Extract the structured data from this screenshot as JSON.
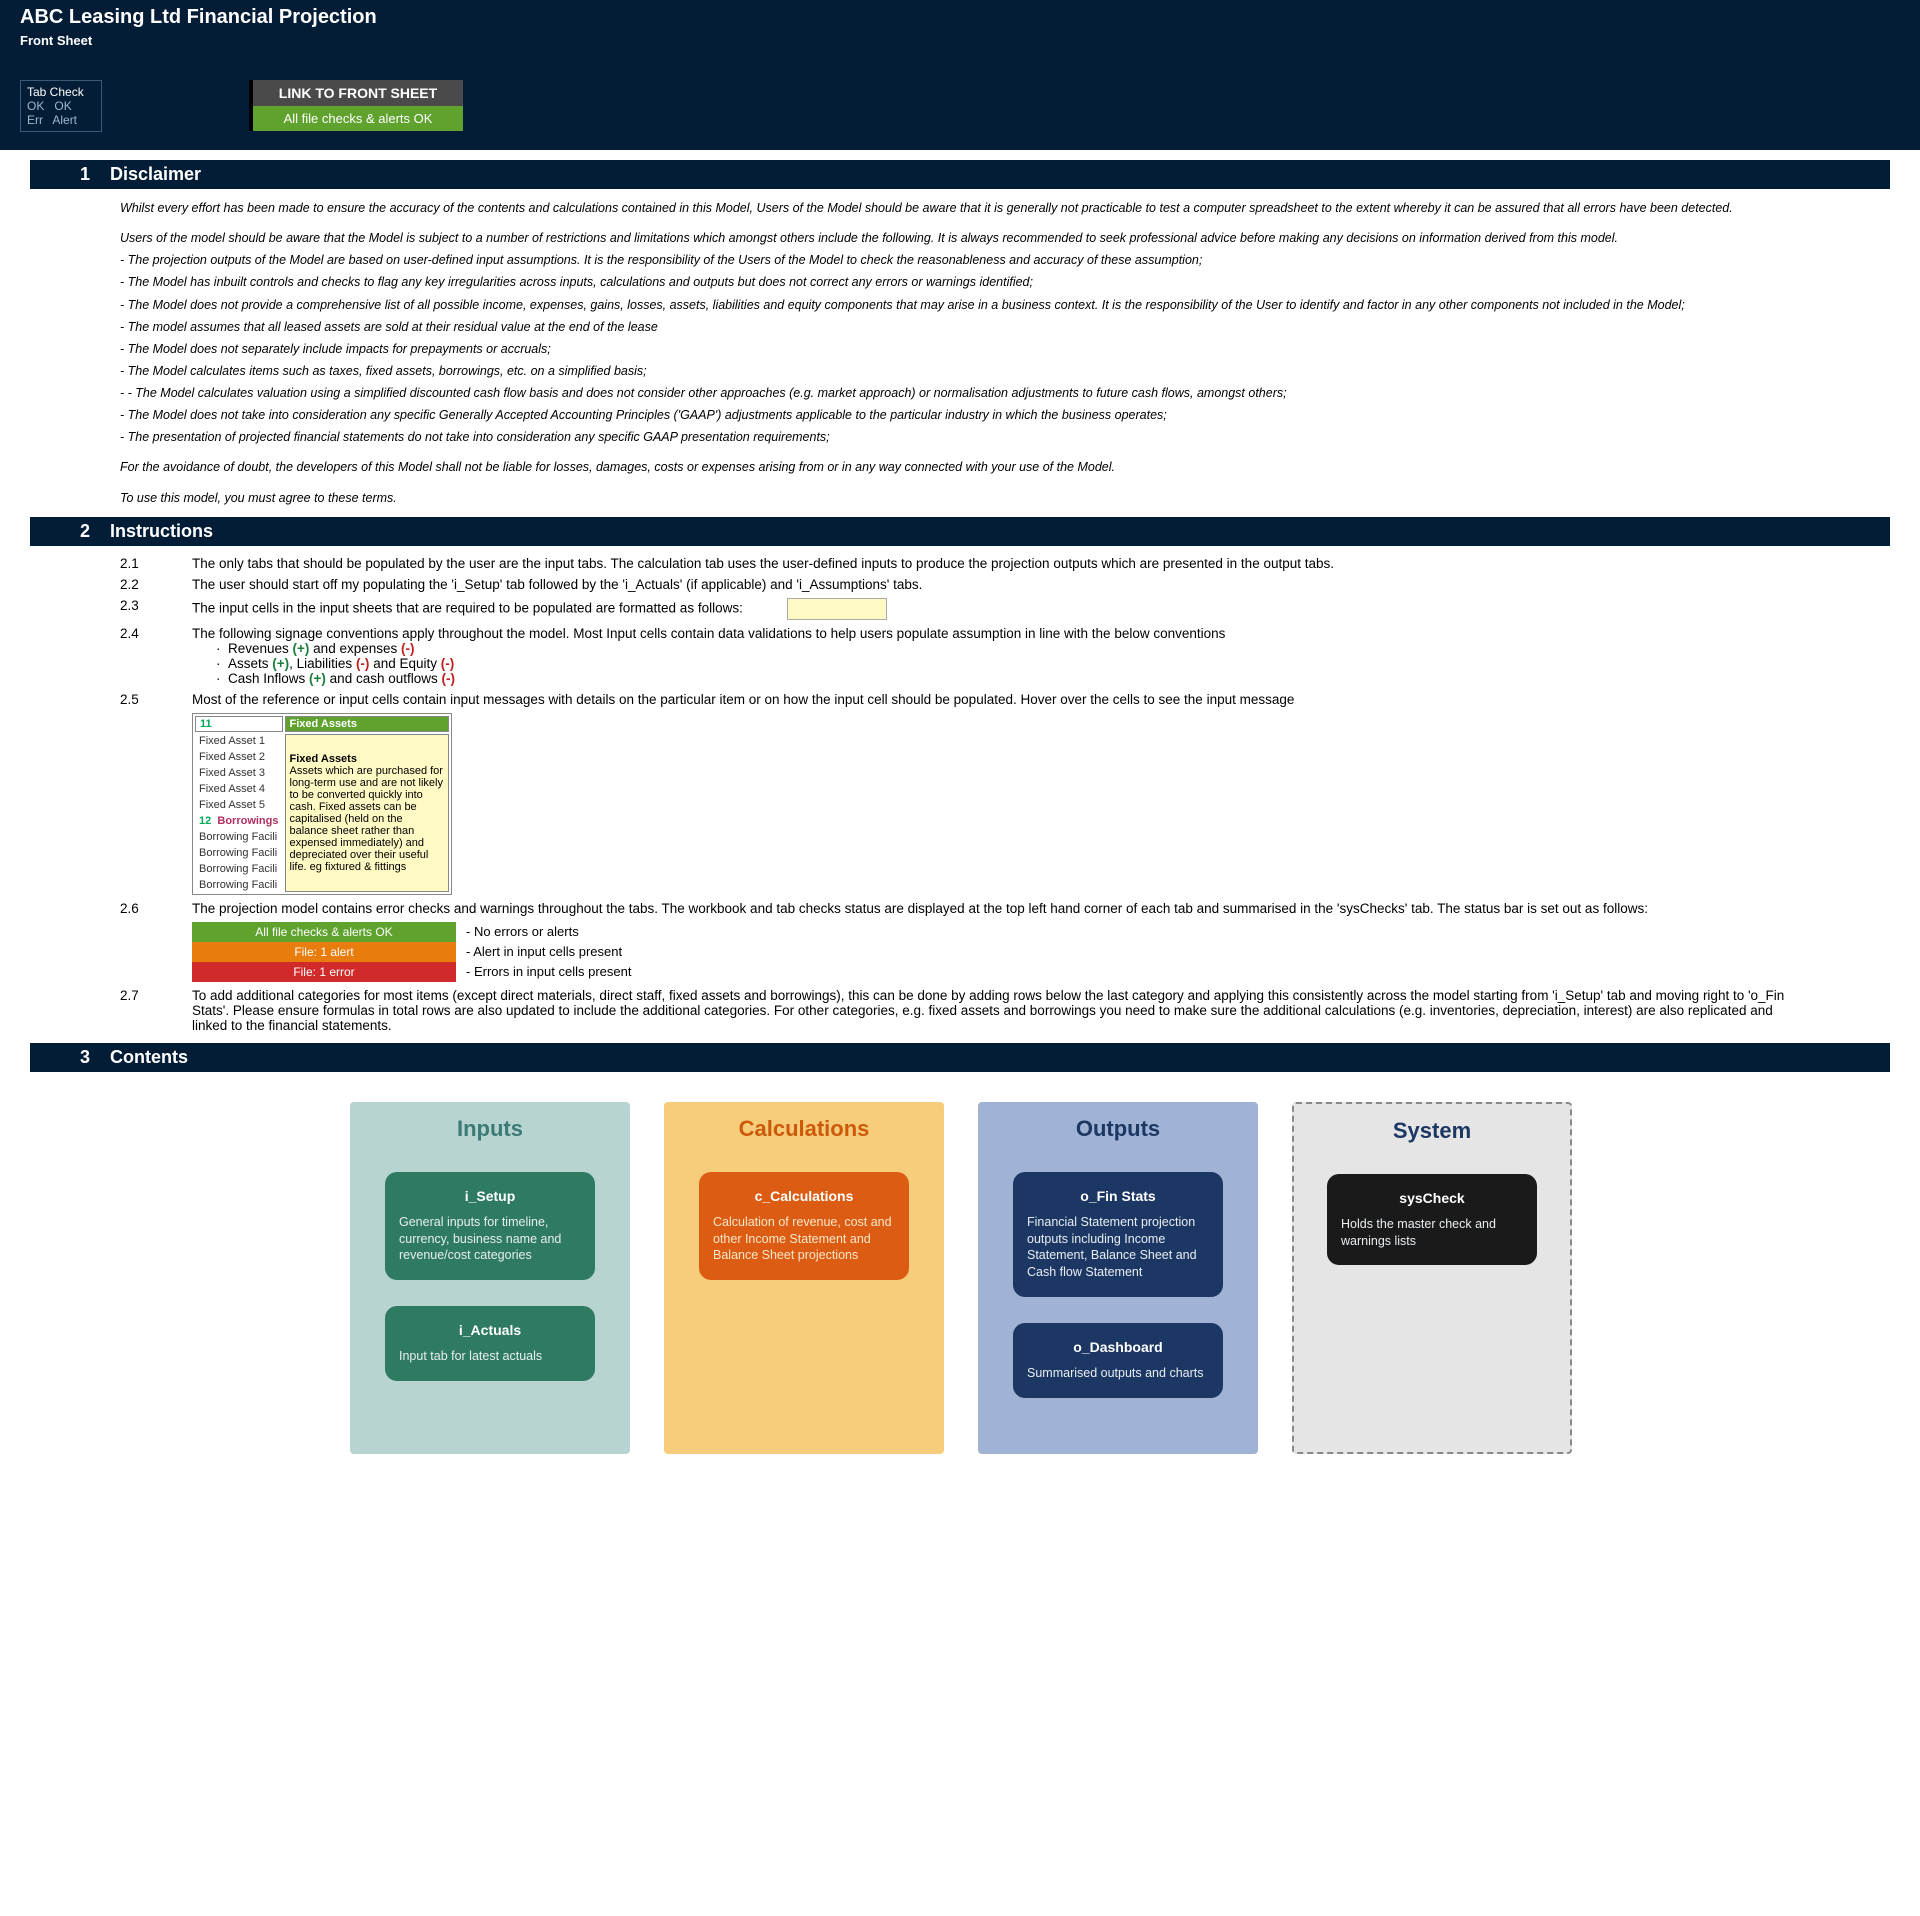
{
  "header": {
    "title": "ABC Leasing Ltd Financial Projection",
    "subtitle": "Front Sheet",
    "tab_check_label": "Tab Check",
    "tab_ok1": "OK",
    "tab_ok2": "OK",
    "tab_err": "Err",
    "tab_alert": "Alert",
    "link_top": "LINK TO FRONT SHEET",
    "link_bot": "All file checks & alerts OK"
  },
  "sections": {
    "disclaimer_num": "1",
    "disclaimer_title": "Disclaimer",
    "instructions_num": "2",
    "instructions_title": "Instructions",
    "contents_num": "3",
    "contents_title": "Contents"
  },
  "disclaimer": {
    "p1": "Whilst every effort has been made to ensure the accuracy of the contents and calculations contained in this Model, Users of the Model should be aware that it is generally not practicable to test a computer spreadsheet to the extent whereby it can be assured that all errors have been detected.",
    "p2": "Users of the model should be aware that the Model is subject to a number of restrictions and limitations which amongst others include the following. It is always recommended to seek professional advice before making any decisions on information derived from this model.",
    "b1": "- The projection outputs of the Model are based on user-defined input assumptions. It is the responsibility of the Users of the Model to check the reasonableness and accuracy of these assumption;",
    "b2": "- The Model has inbuilt controls and checks to flag any key irregularities across inputs, calculations and outputs but does not correct any errors or warnings identified;",
    "b3": "- The Model does not provide a comprehensive list of all possible income, expenses, gains, losses, assets, liabilities and equity components that may arise in a business context. It is the responsibility of the User to identify and factor in any other components not included in the Model;",
    "b4": "- The model assumes that all leased assets are sold at their residual value at the end of the lease",
    "b5": "- The Model does not separately include impacts for prepayments or accruals;",
    "b6": "- The Model calculates items such as taxes, fixed assets, borrowings, etc. on a simplified basis;",
    "b7": "- - The Model calculates valuation using a simplified discounted cash flow basis and does not consider other approaches (e.g. market approach) or normalisation adjustments to future cash flows, amongst others;",
    "b8": "- The Model does not take into consideration any specific Generally Accepted Accounting Principles ('GAAP') adjustments applicable to the particular industry in which the business operates;",
    "b9": "- The presentation of projected financial statements do not take into consideration any specific GAAP presentation requirements;",
    "p3": "For the avoidance of doubt, the developers of this Model shall not be liable for losses, damages, costs or expenses arising from or in any way connected with your use of the Model.",
    "p4": "To use this model, you must agree to these terms."
  },
  "instr": {
    "n21": "2.1",
    "t21": "The only tabs that should be populated by the user are the input tabs. The calculation tab uses the user-defined inputs to produce the projection outputs which are presented in the output tabs.",
    "n22": "2.2",
    "t22": "The user should start off my populating the 'i_Setup' tab followed by the 'i_Actuals' (if applicable) and 'i_Assumptions' tabs.",
    "n23": "2.3",
    "t23": "The input cells in the input sheets that are required to be populated are formatted as follows:",
    "n24": "2.4",
    "t24": "The following signage conventions apply throughout the model. Most Input cells contain data validations to help users populate assumption in line with the below conventions",
    "sign1a": "Revenues ",
    "sign1b": " and expenses ",
    "sign2a": "Assets ",
    "sign2b": ", Liabilities ",
    "sign2c": " and Equity ",
    "sign3a": "Cash Inflows ",
    "sign3b": " and cash outflows ",
    "plus": "(+)",
    "minus": "(-)",
    "n25": "2.5",
    "t25": "Most of the reference or input cells contain input messages with details on the particular item or on how the input cell should be populated. Hover over the cells to see the input message",
    "tip_num11": "11",
    "tip_head11": "Fixed Assets",
    "tip_fa1": "Fixed Asset 1",
    "tip_fa2": "Fixed Asset 2",
    "tip_fa3": "Fixed Asset 3",
    "tip_fa4": "Fixed Asset 4",
    "tip_fa5": "Fixed Asset 5",
    "tip_title": "Fixed Assets",
    "tip_body": "Assets which are purchased for long-term use and are not likely to be converted quickly into cash. Fixed assets can be capitalised (held on the balance sheet rather than expensed immediately) and depreciated over their useful life. eg fixtured & fittings",
    "tip_num12": "12",
    "tip_head12": "Borrowings",
    "tip_bf": "Borrowing Facili",
    "n26": "2.6",
    "t26": "The projection model contains error checks and warnings throughout the tabs. The workbook and tab checks status are displayed at the top left hand corner of each tab and summarised in the 'sysChecks' tab. The status bar is set out as follows:",
    "sb_g": "All file checks & alerts OK",
    "sb_g_lab": "- No errors or alerts",
    "sb_o": "File: 1 alert",
    "sb_o_lab": "- Alert in input cells present",
    "sb_r": "File: 1 error",
    "sb_r_lab": "- Errors in input cells present",
    "n27": "2.7",
    "t27": "To add additional categories for most items (except direct materials, direct staff, fixed assets and borrowings), this can be done by adding rows below the last category and applying this consistently across the model starting from 'i_Setup' tab and moving right to 'o_Fin Stats'. Please ensure formulas in total rows are also updated to include the additional categories. For other categories, e.g. fixed assets and borrowings you need to make sure the additional calculations (e.g. inventories, depreciation, interest) are also replicated and linked to the financial statements."
  },
  "contents": {
    "col_inputs": "Inputs",
    "col_calc": "Calculations",
    "col_out": "Outputs",
    "col_sys": "System",
    "c_setup_t": "i_Setup",
    "c_setup_d": "General inputs for timeline, currency, business name and revenue/cost categories",
    "c_act_t": "i_Actuals",
    "c_act_d": "Input tab for latest actuals",
    "c_calc_t": "c_Calculations",
    "c_calc_d": "Calculation of revenue, cost and other Income Statement and Balance Sheet projections",
    "c_fin_t": "o_Fin Stats",
    "c_fin_d": "Financial Statement projection outputs including Income Statement, Balance Sheet and Cash flow Statement",
    "c_dash_t": "o_Dashboard",
    "c_dash_d": "Summarised outputs and charts",
    "c_sys_t": "sysCheck",
    "c_sys_d": "Holds the master check and warnings lists"
  }
}
